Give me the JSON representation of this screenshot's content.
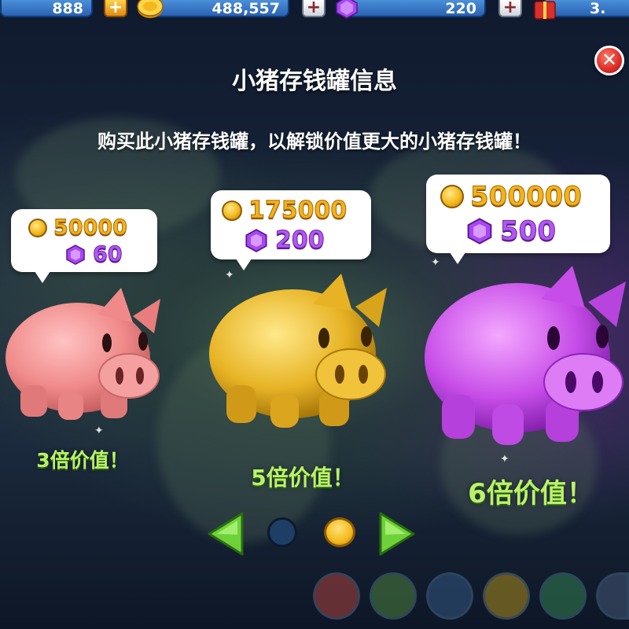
{
  "topbar": {
    "energy_value": "888",
    "coins_value": "488,557",
    "gems_value": "220",
    "gift_value": "3."
  },
  "header": {
    "title": "小猪存钱罐信息",
    "subtitle": "购买此小猪存钱罐，以解锁价值更大的小猪存钱罐！"
  },
  "piggy_banks": [
    {
      "name": "pink",
      "coins": "50000",
      "gems": "60",
      "multiplier": "3倍价值！",
      "color": "#f08a8a"
    },
    {
      "name": "gold",
      "coins": "175000",
      "gems": "200",
      "multiplier": "5倍价值！",
      "color": "#e7b324"
    },
    {
      "name": "purple",
      "coins": "500000",
      "gems": "500",
      "multiplier": "6倍价值！",
      "color": "#c74de8"
    }
  ],
  "pagination": {
    "pages": 2,
    "current": 2
  },
  "colors": {
    "accent_green": "#b9f26a",
    "coin_gold": "#f2b21a",
    "gem_purple": "#b258f0",
    "close_red": "#e0302a"
  },
  "icons": [
    "plus-icon",
    "coin-icon",
    "gem-icon",
    "gift-icon",
    "close-icon",
    "arrow-left-icon",
    "arrow-right-icon"
  ]
}
